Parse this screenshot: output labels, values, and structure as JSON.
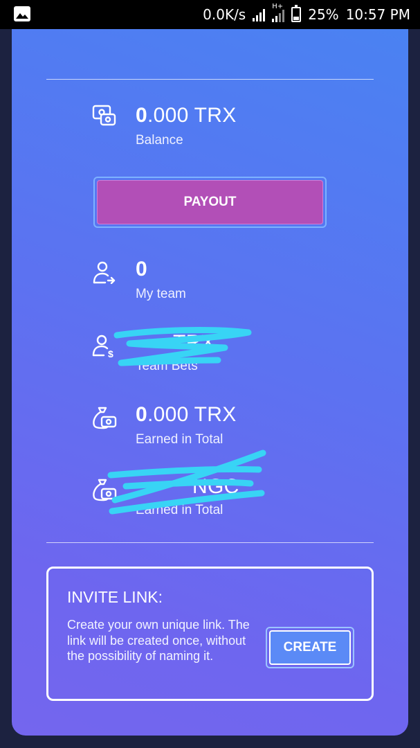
{
  "status_bar": {
    "speed": "0.0K/s",
    "network_type": "H+",
    "battery": "25%",
    "time": "10:57 PM"
  },
  "stats": {
    "balance": {
      "value_bold": "0",
      "value_rest": ".000 TRX",
      "label": "Balance"
    },
    "my_team": {
      "value_bold": "0",
      "value_rest": "",
      "label": "My team"
    },
    "team_bets": {
      "value_bold": "",
      "value_rest": "TRX",
      "label": "Team Bets"
    },
    "earned_total": {
      "value_bold": "0",
      "value_rest": ".000 TRX",
      "label": "Earned in Total"
    },
    "earned_total_2": {
      "value_bold": "",
      "value_rest": "NGC",
      "label": "Earned in Total"
    }
  },
  "payout": {
    "label": "PAYOUT"
  },
  "invite": {
    "title": "INVITE LINK:",
    "description": "Create your own unique link. The link will be created once, without the possibility of naming it.",
    "create_label": "CREATE"
  },
  "colors": {
    "payout_button": "#b24fb7",
    "create_button": "#5b8af6",
    "scribble": "#38d4f5"
  },
  "icons": [
    "gallery-icon",
    "signal-icon",
    "battery-icon",
    "money-icon",
    "team-icon",
    "team-bets-icon",
    "money-bag-icon"
  ]
}
